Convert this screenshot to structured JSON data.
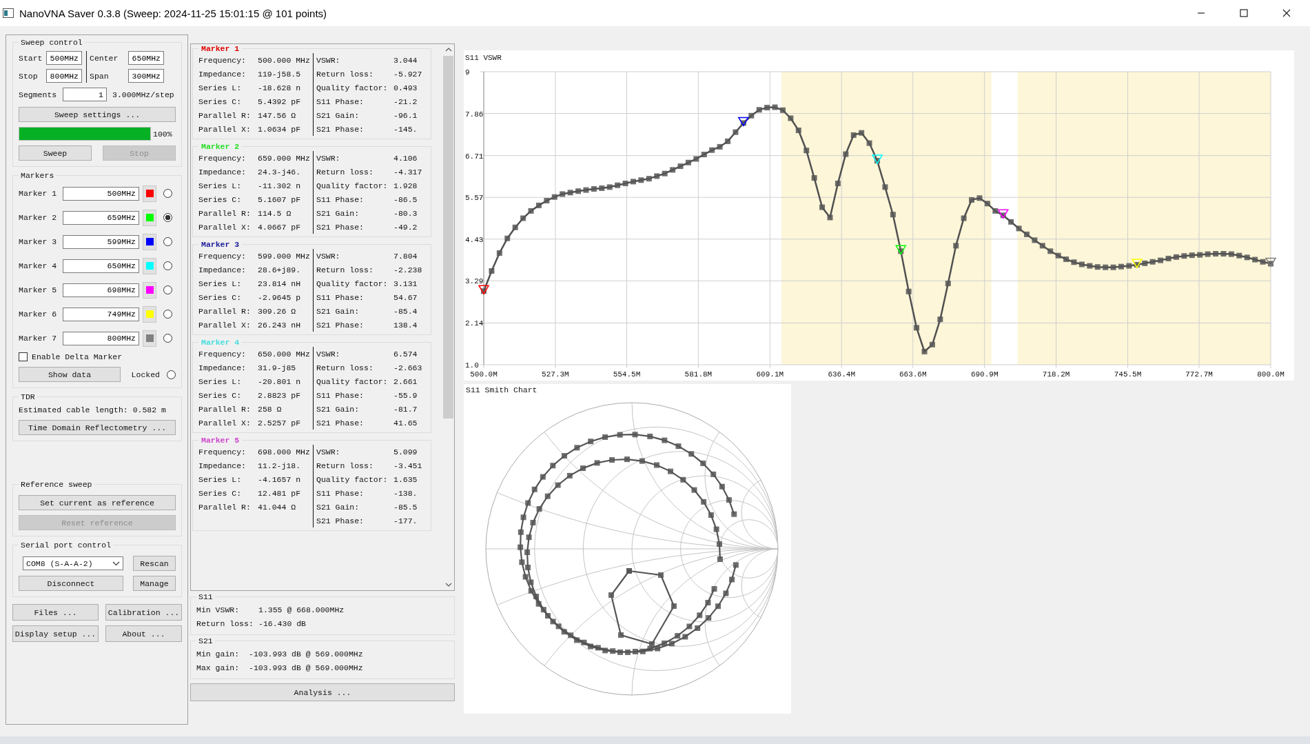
{
  "window": {
    "title": "NanoVNA Saver 0.3.8 (Sweep: 2024-11-25 15:01:15 @ 101 points)"
  },
  "sweep_control": {
    "title": "Sweep control",
    "fields": [
      {
        "label": "Start",
        "value": "500MHz"
      },
      {
        "label": "Center",
        "value": "650MHz"
      },
      {
        "label": "Stop",
        "value": "800MHz"
      },
      {
        "label": "Span",
        "value": "300MHz"
      }
    ],
    "segments": {
      "label": "Segments",
      "value": "1"
    },
    "step": "3.000MHz/step",
    "settings_button": "Sweep settings ...",
    "progress": {
      "level": 1,
      "reading": "100%"
    },
    "buttons": [
      {
        "label": "Sweep",
        "disabled": false
      },
      {
        "label": "Stop",
        "disabled": true
      }
    ]
  },
  "markers": {
    "title": "Markers",
    "items": [
      {
        "label": "Marker 1",
        "value": "500MHz",
        "color": "#ff0000",
        "selected": false
      },
      {
        "label": "Marker 2",
        "value": "659MHz",
        "color": "#00ff00",
        "selected": true
      },
      {
        "label": "Marker 3",
        "value": "599MHz",
        "color": "#0000ff",
        "selected": false
      },
      {
        "label": "Marker 4",
        "value": "650MHz",
        "color": "#00ffff",
        "selected": false
      },
      {
        "label": "Marker 5",
        "value": "698MHz",
        "color": "#ff00ff",
        "selected": false
      },
      {
        "label": "Marker 6",
        "value": "749MHz",
        "color": "#ffff00",
        "selected": false
      },
      {
        "label": "Marker 7",
        "value": "800MHz",
        "color": "#808080",
        "selected": false
      }
    ],
    "delta": {
      "label": "Enable Delta Marker",
      "checked": false
    },
    "show_data": "Show data",
    "locked": {
      "label": "Locked",
      "selected": false
    }
  },
  "tdr": {
    "title": "TDR",
    "cable_length": "Estimated cable length: 0.582 m",
    "button": "Time Domain Reflectometry ..."
  },
  "reference_sweep": {
    "title": "Reference sweep",
    "buttons": [
      {
        "label": "Set current as reference",
        "disabled": false
      },
      {
        "label": "Reset reference",
        "disabled": true
      }
    ]
  },
  "serial_port": {
    "title": "Serial port control",
    "port": "COM8 (S-A-A-2)",
    "rescan": "Rescan",
    "disconnect": "Disconnect",
    "manage": "Manage"
  },
  "bottom_buttons": [
    "Files ...",
    "Calibration ...",
    "Display setup ...",
    "About ..."
  ],
  "marker_data": [
    {
      "title": "Marker 1",
      "color": "#e00000",
      "left": [
        {
          "label": "Frequency:",
          "value": "500.000 MHz"
        },
        {
          "label": "Impedance:",
          "value": "119-j58.5"
        },
        {
          "label": "Series L:",
          "value": "-18.628 n"
        },
        {
          "label": "Series C:",
          "value": "5.4392 pF"
        },
        {
          "label": "Parallel R:",
          "value": "147.56 Ω"
        },
        {
          "label": "Parallel X:",
          "value": "1.0634 pF"
        }
      ],
      "right": [
        {
          "label": "VSWR:",
          "value": "3.044"
        },
        {
          "label": "Return loss:",
          "value": "-5.927"
        },
        {
          "label": "Quality factor:",
          "value": "0.493"
        },
        {
          "label": "S11 Phase:",
          "value": "-21.2"
        },
        {
          "label": "S21 Gain:",
          "value": "-96.1"
        },
        {
          "label": "S21 Phase:",
          "value": "-145."
        }
      ]
    },
    {
      "title": "Marker 2",
      "color": "#22dd22",
      "left": [
        {
          "label": "Frequency:",
          "value": "659.000 MHz"
        },
        {
          "label": "Impedance:",
          "value": "24.3-j46."
        },
        {
          "label": "Series L:",
          "value": "-11.302 n"
        },
        {
          "label": "Series C:",
          "value": "5.1607 pF"
        },
        {
          "label": "Parallel R:",
          "value": "114.5 Ω"
        },
        {
          "label": "Parallel X:",
          "value": "4.0667 pF"
        }
      ],
      "right": [
        {
          "label": "VSWR:",
          "value": "4.106"
        },
        {
          "label": "Return loss:",
          "value": "-4.317"
        },
        {
          "label": "Quality factor:",
          "value": "1.928"
        },
        {
          "label": "S11 Phase:",
          "value": "-86.5"
        },
        {
          "label": "S21 Gain:",
          "value": "-80.3"
        },
        {
          "label": "S21 Phase:",
          "value": "-49.2"
        }
      ]
    },
    {
      "title": "Marker 3",
      "color": "#1a1a9a",
      "left": [
        {
          "label": "Frequency:",
          "value": "599.000 MHz"
        },
        {
          "label": "Impedance:",
          "value": "28.6+j89."
        },
        {
          "label": "Series L:",
          "value": "23.814 nH"
        },
        {
          "label": "Series C:",
          "value": "-2.9645 p"
        },
        {
          "label": "Parallel R:",
          "value": "309.26 Ω"
        },
        {
          "label": "Parallel X:",
          "value": "26.243 nH"
        }
      ],
      "right": [
        {
          "label": "VSWR:",
          "value": "7.804"
        },
        {
          "label": "Return loss:",
          "value": "-2.238"
        },
        {
          "label": "Quality factor:",
          "value": "3.131"
        },
        {
          "label": "S11 Phase:",
          "value": "54.67"
        },
        {
          "label": "S21 Gain:",
          "value": "-85.4"
        },
        {
          "label": "S21 Phase:",
          "value": "138.4"
        }
      ]
    },
    {
      "title": "Marker 4",
      "color": "#44dddd",
      "left": [
        {
          "label": "Frequency:",
          "value": "650.000 MHz"
        },
        {
          "label": "Impedance:",
          "value": "31.9-j85"
        },
        {
          "label": "Series L:",
          "value": "-20.801 n"
        },
        {
          "label": "Series C:",
          "value": "2.8823 pF"
        },
        {
          "label": "Parallel R:",
          "value": "258 Ω"
        },
        {
          "label": "Parallel X:",
          "value": "2.5257 pF"
        }
      ],
      "right": [
        {
          "label": "VSWR:",
          "value": "6.574"
        },
        {
          "label": "Return loss:",
          "value": "-2.663"
        },
        {
          "label": "Quality factor:",
          "value": "2.661"
        },
        {
          "label": "S11 Phase:",
          "value": "-55.9"
        },
        {
          "label": "S21 Gain:",
          "value": "-81.7"
        },
        {
          "label": "S21 Phase:",
          "value": "41.65"
        }
      ]
    },
    {
      "title": "Marker 5",
      "color": "#cc44cc",
      "left": [
        {
          "label": "Frequency:",
          "value": "698.000 MHz"
        },
        {
          "label": "Impedance:",
          "value": "11.2-j18."
        },
        {
          "label": "Series L:",
          "value": "-4.1657 n"
        },
        {
          "label": "Series C:",
          "value": "12.481 pF"
        },
        {
          "label": "Parallel R:",
          "value": "41.044 Ω"
        }
      ],
      "right": [
        {
          "label": "VSWR:",
          "value": "5.099"
        },
        {
          "label": "Return loss:",
          "value": "-3.451"
        },
        {
          "label": "Quality factor:",
          "value": "1.635"
        },
        {
          "label": "S11 Phase:",
          "value": "-138."
        },
        {
          "label": "S21 Gain:",
          "value": "-85.5"
        },
        {
          "label": "S21 Phase:",
          "value": "-177."
        }
      ]
    }
  ],
  "s11": {
    "title": "S11",
    "rows": [
      {
        "label": "Min VSWR:",
        "value": "1.355 @ 668.000MHz"
      },
      {
        "label": "Return loss:",
        "value": "-16.430 dB"
      }
    ]
  },
  "s21": {
    "title": "S21",
    "rows": [
      {
        "label": "Min gain:",
        "value": "-103.993 dB @ 569.000MHz"
      },
      {
        "label": "Max gain:",
        "value": "-103.993 dB @ 569.000MHz"
      }
    ]
  },
  "analysis_button": "Analysis ...",
  "vswr_chart": {
    "chart_data": {
      "type": "line",
      "title": "S11 VSWR",
      "xlim": [
        500,
        800
      ],
      "ylim": [
        1,
        9
      ],
      "xticks": [
        {
          "value": 500,
          "label": "500.0M"
        },
        {
          "value": 527.3,
          "label": "527.3M"
        },
        {
          "value": 554.5,
          "label": "554.5M"
        },
        {
          "value": 581.8,
          "label": "581.8M"
        },
        {
          "value": 609.1,
          "label": "609.1M"
        },
        {
          "value": 636.4,
          "label": "636.4M"
        },
        {
          "value": 663.6,
          "label": "663.6M"
        },
        {
          "value": 690.9,
          "label": "690.9M"
        },
        {
          "value": 718.2,
          "label": "718.2M"
        },
        {
          "value": 745.5,
          "label": "745.5M"
        },
        {
          "value": 772.7,
          "label": "772.7M"
        },
        {
          "value": 800,
          "label": "800.0M"
        }
      ],
      "yticks": [
        {
          "value": 1,
          "label": "1.0"
        },
        2.14,
        3.29,
        4.43,
        5.57,
        6.71,
        7.86,
        9
      ],
      "x": [
        500,
        503,
        506,
        509,
        512,
        515,
        518,
        521,
        524,
        527,
        530,
        533,
        536,
        539,
        542,
        545,
        548,
        551,
        554,
        557,
        560,
        563,
        566,
        569,
        572,
        575,
        578,
        581,
        584,
        587,
        590,
        593,
        596,
        599,
        602,
        605,
        608,
        611,
        614,
        617,
        620,
        623,
        626,
        629,
        632,
        635,
        638,
        641,
        644,
        647,
        650,
        653,
        656,
        659,
        662,
        665,
        668,
        671,
        674,
        677,
        680,
        683,
        686,
        689,
        692,
        695,
        698,
        701,
        704,
        707,
        710,
        713,
        716,
        719,
        722,
        725,
        728,
        731,
        734,
        737,
        740,
        743,
        746,
        749,
        752,
        755,
        758,
        761,
        764,
        767,
        770,
        773,
        776,
        779,
        782,
        785,
        788,
        791,
        794,
        797,
        800
      ],
      "grid": true,
      "series": [
        {
          "color": "#505050",
          "marker": "square",
          "values": [
            3.01,
            3.56,
            4.05,
            4.45,
            4.75,
            5.0,
            5.2,
            5.35,
            5.48,
            5.58,
            5.66,
            5.7,
            5.74,
            5.77,
            5.8,
            5.82,
            5.85,
            5.9,
            5.95,
            6.0,
            6.04,
            6.08,
            6.15,
            6.22,
            6.32,
            6.42,
            6.52,
            6.62,
            6.74,
            6.86,
            6.95,
            7.1,
            7.35,
            7.6,
            7.8,
            7.96,
            8.02,
            8.03,
            7.95,
            7.73,
            7.4,
            6.85,
            6.1,
            5.3,
            5.02,
            5.95,
            6.75,
            7.27,
            7.33,
            7.05,
            6.57,
            5.85,
            5.1,
            4.1,
            3.0,
            2.01,
            1.36,
            1.55,
            2.24,
            3.22,
            4.25,
            5.0,
            5.5,
            5.55,
            5.4,
            5.2,
            5.08,
            4.9,
            4.72,
            4.56,
            4.4,
            4.25,
            4.1,
            3.98,
            3.88,
            3.8,
            3.74,
            3.7,
            3.67,
            3.66,
            3.66,
            3.68,
            3.7,
            3.73,
            3.77,
            3.81,
            3.85,
            3.9,
            3.94,
            3.97,
            3.99,
            4.0,
            4.02,
            4.03,
            4.03,
            4.02,
            3.98,
            3.93,
            3.87,
            3.81,
            3.76
          ]
        }
      ]
    }
  },
  "smith_chart": {
    "title": "S11 Smith Chart"
  }
}
